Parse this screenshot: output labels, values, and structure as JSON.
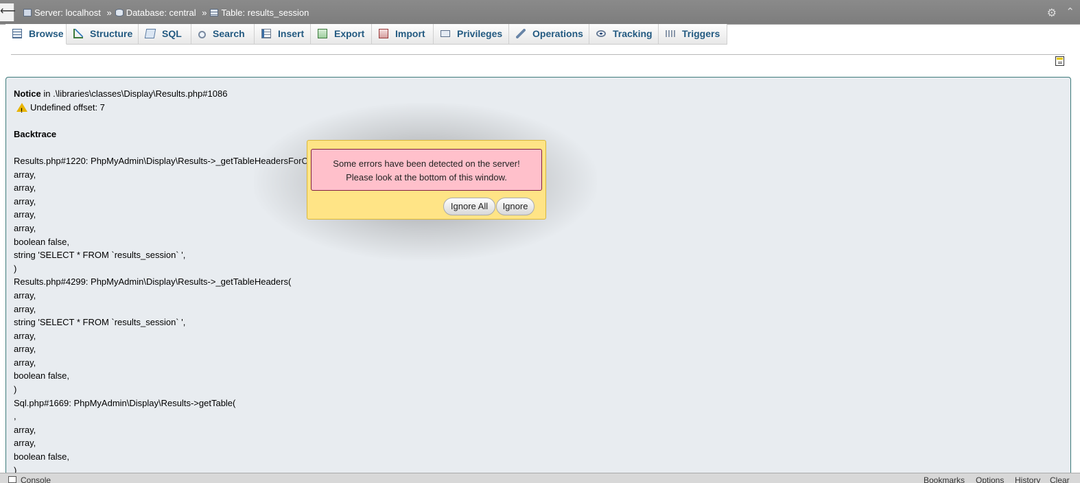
{
  "breadcrumb": {
    "back_glyph": "⟵",
    "server": "Server: localhost",
    "database": "Database: central",
    "table": "Table: results_session",
    "separator": "»"
  },
  "tabs": [
    {
      "label": "Browse",
      "icon": "browse-icon",
      "active": true
    },
    {
      "label": "Structure",
      "icon": "structure-icon"
    },
    {
      "label": "SQL",
      "icon": "sql-icon"
    },
    {
      "label": "Search",
      "icon": "search-icon"
    },
    {
      "label": "Insert",
      "icon": "insert-icon"
    },
    {
      "label": "Export",
      "icon": "export-icon"
    },
    {
      "label": "Import",
      "icon": "import-icon"
    },
    {
      "label": "Privileges",
      "icon": "privileges-icon"
    },
    {
      "label": "Operations",
      "icon": "operations-icon"
    },
    {
      "label": "Tracking",
      "icon": "tracking-icon"
    },
    {
      "label": "Triggers",
      "icon": "triggers-icon"
    }
  ],
  "error": {
    "notice_label": "Notice",
    "notice_location": " in .\\libraries\\classes\\Display\\Results.php#1086",
    "message": "Undefined offset: 7",
    "backtrace_heading": "Backtrace",
    "lines": [
      "Results.php#1220: PhpMyAdmin\\Display\\Results->_getTableHeadersForColumns(",
      "array,",
      "array,",
      "array,",
      "array,",
      "array,",
      "boolean false,",
      "string 'SELECT * FROM `results_session` ',",
      ")",
      "Results.php#4299: PhpMyAdmin\\Display\\Results->_getTableHeaders(",
      "array,",
      "array,",
      "string 'SELECT * FROM `results_session` ',",
      "array,",
      "array,",
      "array,",
      "boolean false,",
      ")",
      "Sql.php#1669: PhpMyAdmin\\Display\\Results->getTable(",
      ",",
      "array,",
      "array,",
      "boolean false,",
      ")"
    ]
  },
  "modal": {
    "message_line1": "Some errors have been detected on the server!",
    "message_line2": "Please look at the bottom of this window.",
    "ignore_all_label": "Ignore All",
    "ignore_label": "Ignore"
  },
  "console": {
    "label": "Console",
    "links": [
      "Bookmarks",
      "Options",
      "History",
      "Clear"
    ]
  }
}
